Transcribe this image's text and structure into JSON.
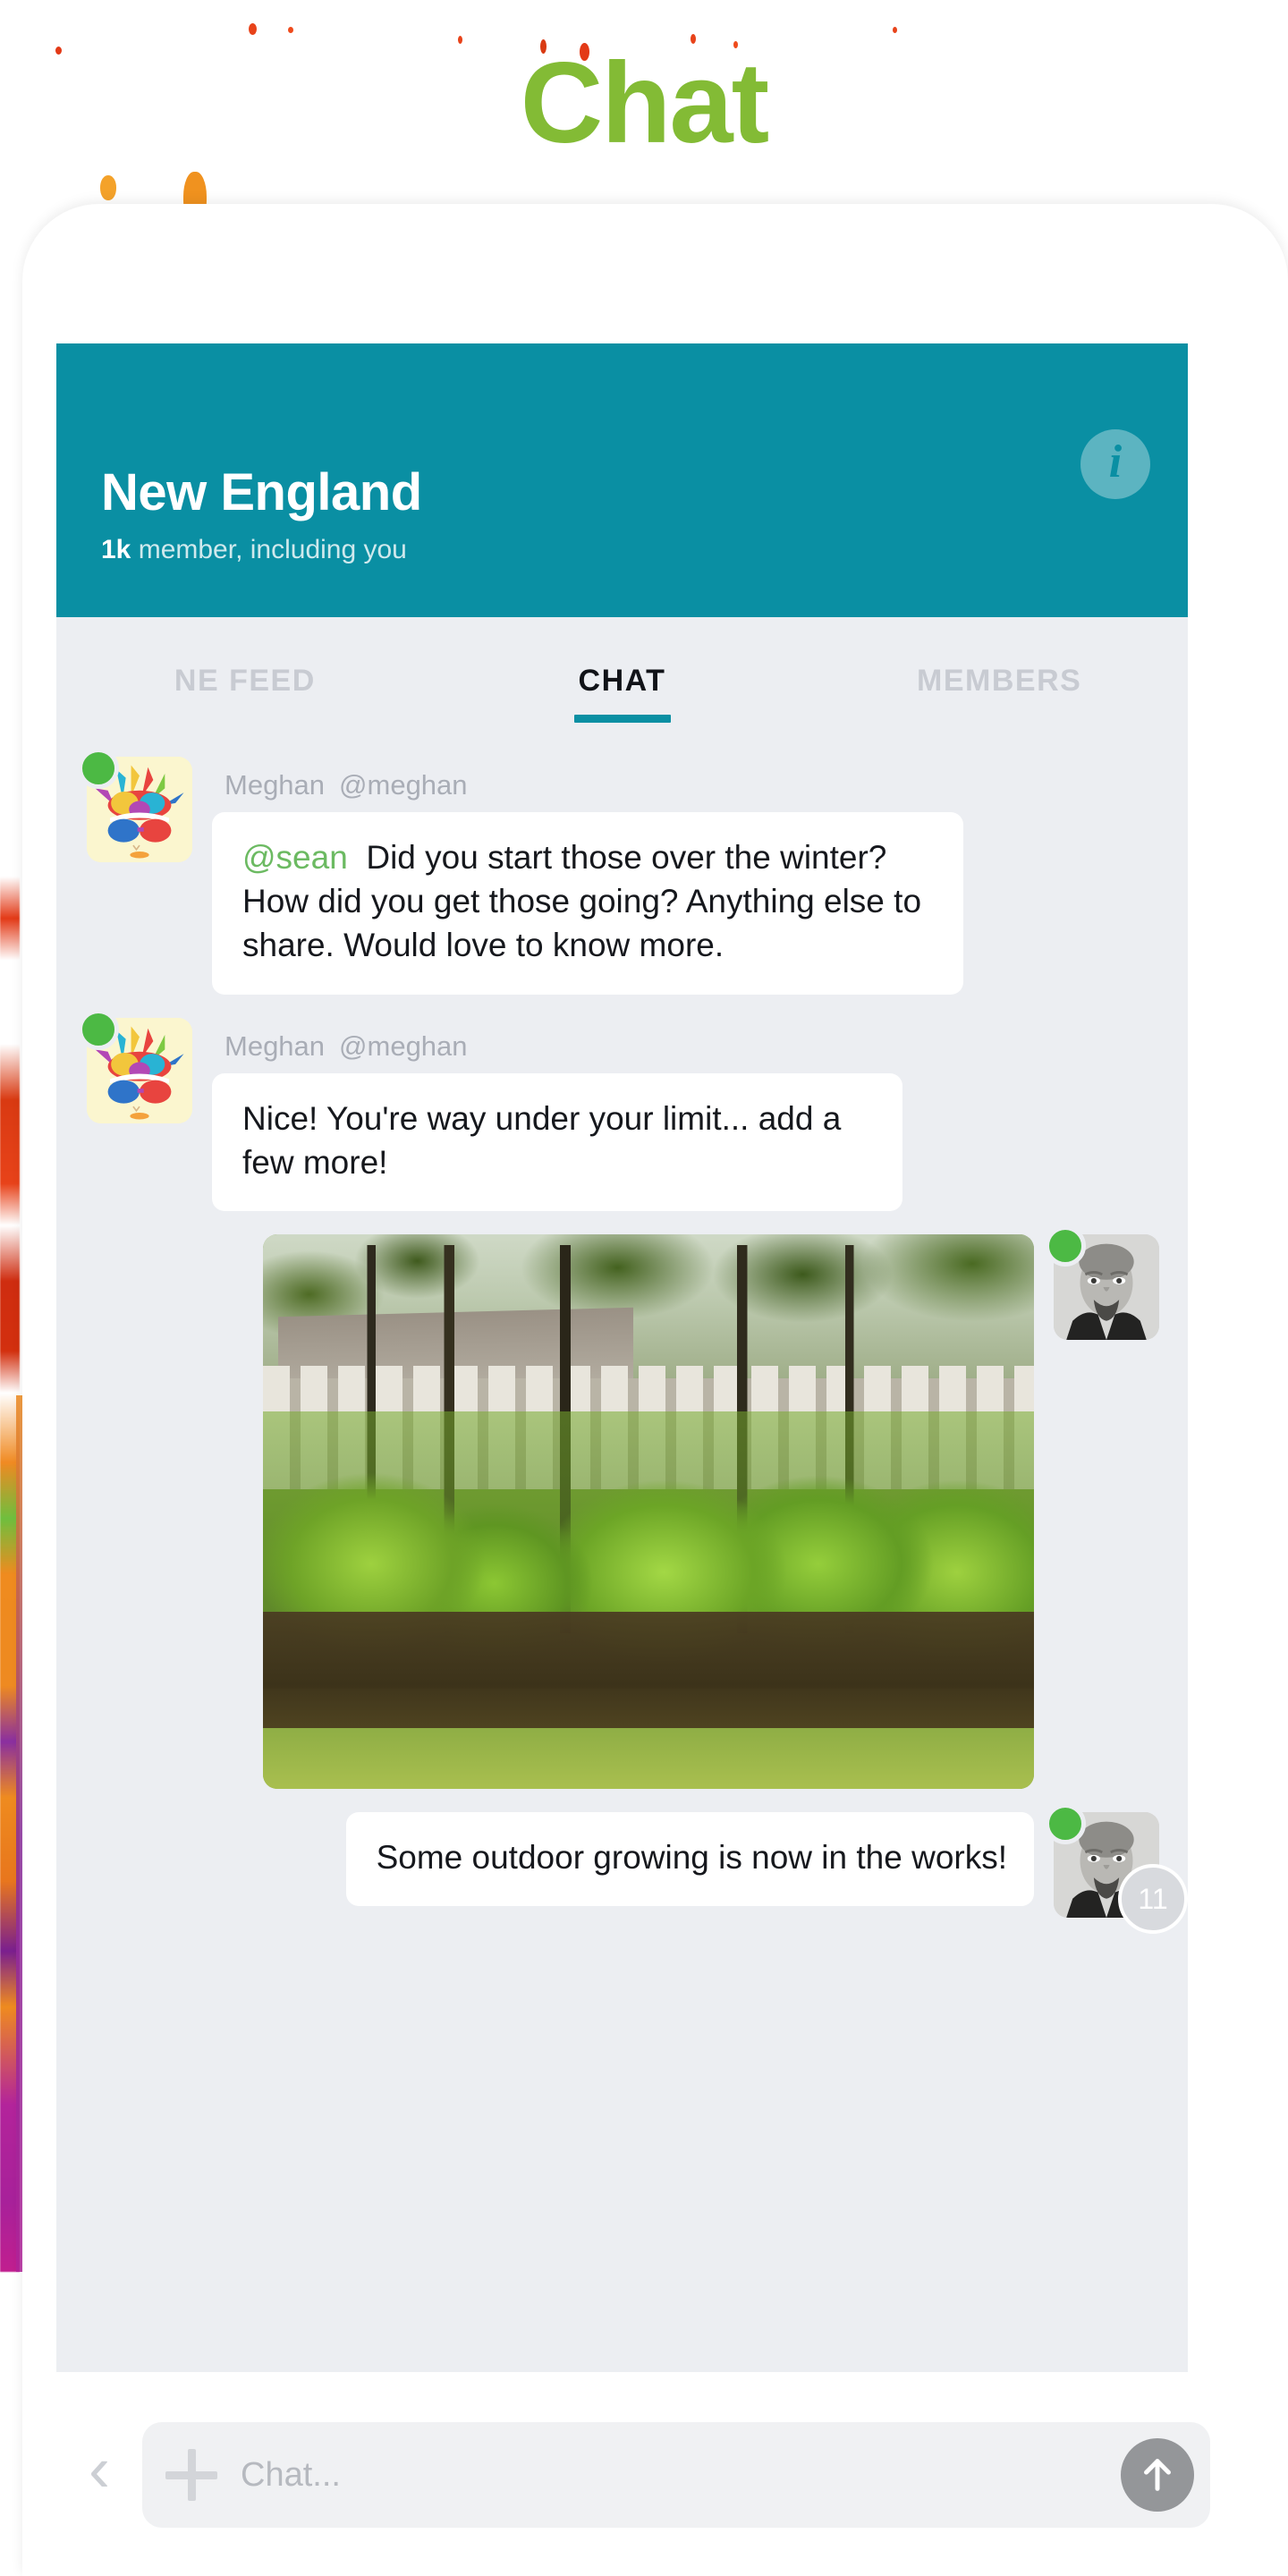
{
  "page": {
    "title": "Chat",
    "title_color": "#83bb35",
    "accent_color": "#0a8fa3",
    "background": "#ffffff"
  },
  "header": {
    "group_name": "New England",
    "member_count": "1k",
    "member_suffix": " member, including you",
    "info_icon": "info-icon",
    "info_label": "i",
    "background": "#0a8fa3"
  },
  "tabs": [
    {
      "label": "NE FEED",
      "active": false
    },
    {
      "label": "CHAT",
      "active": true
    },
    {
      "label": "MEMBERS",
      "active": false
    }
  ],
  "messages": [
    {
      "type": "text",
      "side": "left",
      "author": "Meghan",
      "handle": "@meghan",
      "online": true,
      "avatar": "meghan-avatar",
      "mention": "@sean",
      "text": "Did you start those over the winter? How did you get those going? Anything else to share. Would love to know more."
    },
    {
      "type": "text",
      "side": "left",
      "author": "Meghan",
      "handle": "@meghan",
      "online": true,
      "avatar": "meghan-avatar",
      "mention": "",
      "text": "Nice! You're way under your limit... add a few more!"
    },
    {
      "type": "photo",
      "side": "right",
      "online": true,
      "avatar": "sean-avatar",
      "alt": "outdoor garden with green plants and white picket fence"
    },
    {
      "type": "text",
      "side": "right",
      "online": true,
      "avatar": "sean-avatar",
      "badge": "11",
      "text": "Some outdoor growing is now in the works!"
    }
  ],
  "composer": {
    "back_icon": "chevron-left-icon",
    "add_icon": "plus-icon",
    "placeholder": "Chat...",
    "value": "",
    "send_icon": "arrow-up-icon"
  }
}
